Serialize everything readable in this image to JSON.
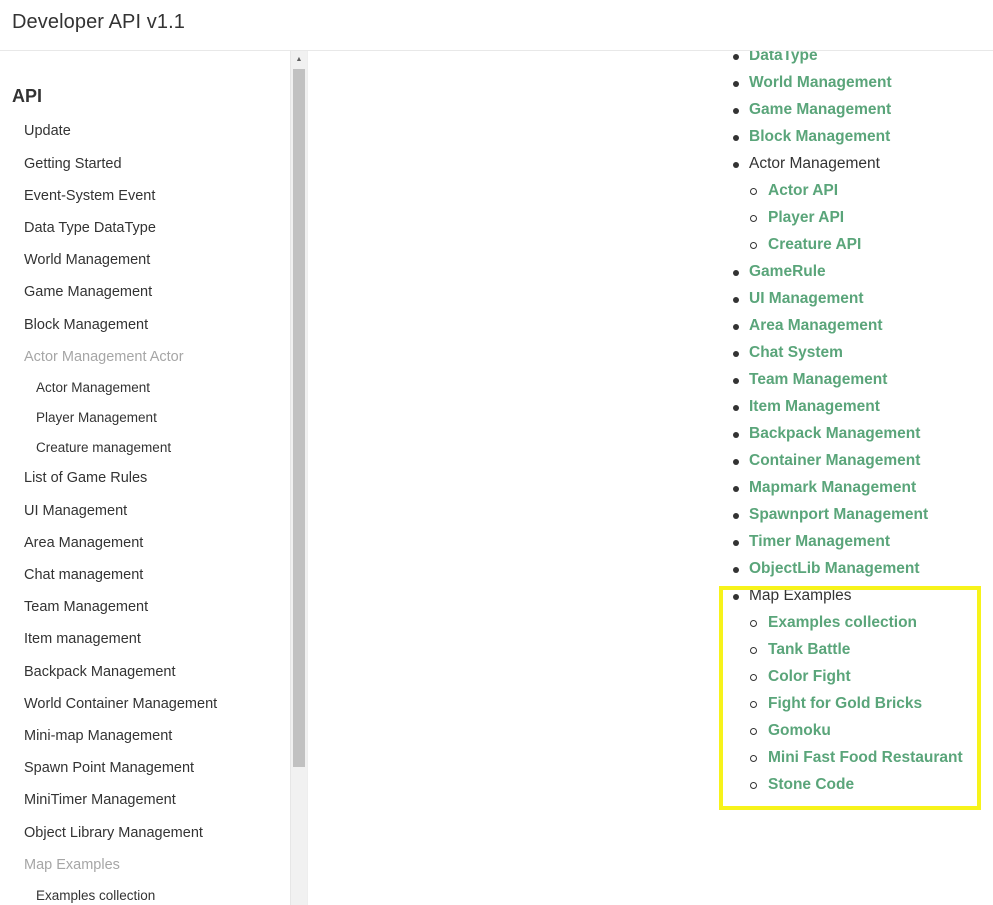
{
  "header": {
    "title": "Developer API v1.1"
  },
  "sidebar": {
    "heading": "API",
    "items": [
      {
        "label": "Update"
      },
      {
        "label": "Getting Started"
      },
      {
        "label": "Event-System Event"
      },
      {
        "label": "Data Type DataType"
      },
      {
        "label": "World Management"
      },
      {
        "label": "Game Management"
      },
      {
        "label": "Block Management"
      },
      {
        "label": "Actor Management Actor"
      },
      {
        "label": "Actor Management"
      },
      {
        "label": "Player Management"
      },
      {
        "label": "Creature management"
      },
      {
        "label": "List of Game Rules"
      },
      {
        "label": "UI Management"
      },
      {
        "label": "Area Management"
      },
      {
        "label": "Chat management"
      },
      {
        "label": "Team Management"
      },
      {
        "label": "Item management"
      },
      {
        "label": "Backpack Management"
      },
      {
        "label": "World Container Management"
      },
      {
        "label": "Mini-map Management"
      },
      {
        "label": "Spawn Point Management"
      },
      {
        "label": "MiniTimer Management"
      },
      {
        "label": "Object Library Management"
      },
      {
        "label": "Map Examples"
      },
      {
        "label": "Examples collection"
      }
    ]
  },
  "toc": {
    "items": [
      {
        "label": "DataType",
        "link": true
      },
      {
        "label": "World Management",
        "link": true
      },
      {
        "label": "Game Management",
        "link": true
      },
      {
        "label": "Block Management",
        "link": true
      },
      {
        "label": "Actor Management",
        "link": false
      },
      {
        "label": "Actor API",
        "link": true
      },
      {
        "label": "Player API",
        "link": true
      },
      {
        "label": "Creature API",
        "link": true
      },
      {
        "label": "GameRule",
        "link": true
      },
      {
        "label": "UI Management",
        "link": true
      },
      {
        "label": "Area Management",
        "link": true
      },
      {
        "label": "Chat System",
        "link": true
      },
      {
        "label": "Team Management",
        "link": true
      },
      {
        "label": "Item Management",
        "link": true
      },
      {
        "label": "Backpack Management",
        "link": true
      },
      {
        "label": "Container Management",
        "link": true
      },
      {
        "label": "Mapmark Management",
        "link": true
      },
      {
        "label": "Spawnport Management",
        "link": true
      },
      {
        "label": "Timer Management",
        "link": true
      },
      {
        "label": "ObjectLib Management",
        "link": true
      },
      {
        "label": "Map Examples",
        "link": false
      },
      {
        "label": "Examples collection",
        "link": true
      },
      {
        "label": "Tank Battle",
        "link": true
      },
      {
        "label": "Color Fight",
        "link": true
      },
      {
        "label": "Fight for Gold Bricks",
        "link": true
      },
      {
        "label": "Gomoku",
        "link": true
      },
      {
        "label": "Mini Fast Food Restaurant",
        "link": true
      },
      {
        "label": "Stone Code",
        "link": true
      }
    ]
  },
  "colors": {
    "link": "#5aa57a",
    "text": "#333333",
    "muted": "#a6a6a6",
    "highlight": "#f7f31a"
  }
}
